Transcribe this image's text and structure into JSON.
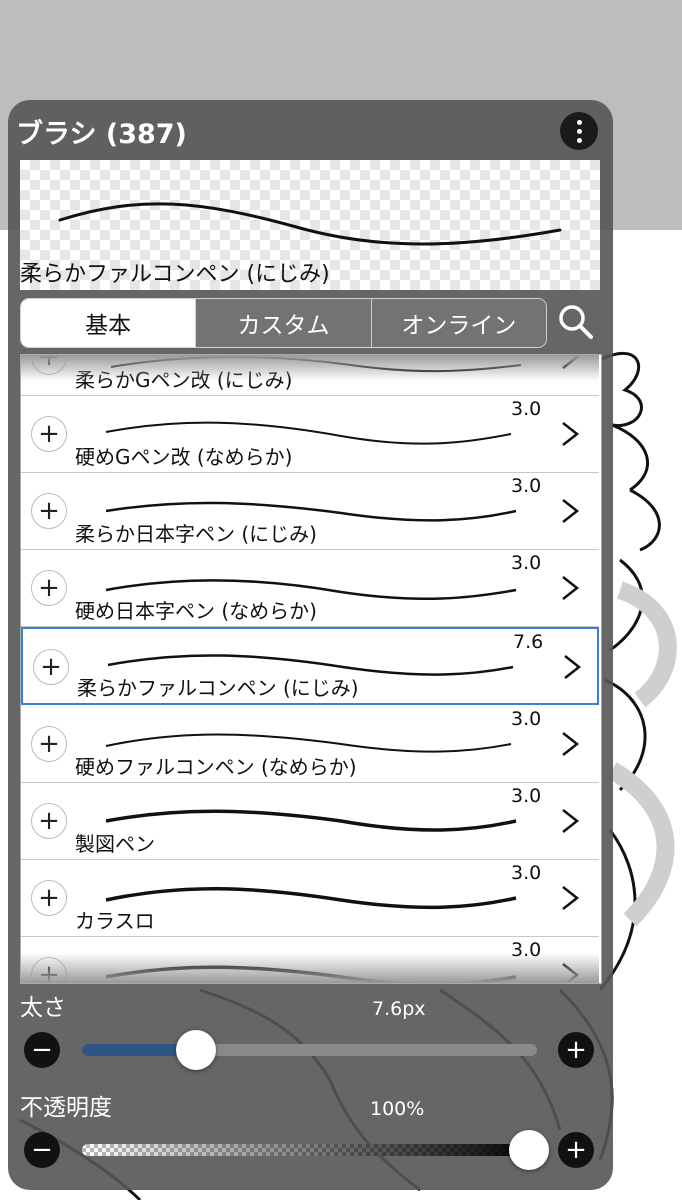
{
  "panel": {
    "title": "ブラシ (387)",
    "preview_name": "柔らかファルコンペン (にじみ)"
  },
  "tabs": [
    {
      "label": "基本",
      "active": true
    },
    {
      "label": "カスタム",
      "active": false
    },
    {
      "label": "オンライン",
      "active": false
    }
  ],
  "brushes": [
    {
      "name": "柔らかGペン改 (にじみ)",
      "size": ""
    },
    {
      "name": "硬めGペン改 (なめらか)",
      "size": "3.0"
    },
    {
      "name": "柔らか日本字ペン (にじみ)",
      "size": "3.0"
    },
    {
      "name": "硬め日本字ペン (なめらか)",
      "size": "3.0"
    },
    {
      "name": "柔らかファルコンペン (にじみ)",
      "size": "7.6",
      "selected": true
    },
    {
      "name": "硬めファルコンペン (なめらか)",
      "size": "3.0"
    },
    {
      "name": "製図ペン",
      "size": "3.0"
    },
    {
      "name": "カラスロ",
      "size": "3.0"
    },
    {
      "name": "",
      "size": "3.0"
    }
  ],
  "sliders": {
    "size": {
      "label": "太さ",
      "value_text": "7.6px",
      "fraction": 0.25
    },
    "opacity": {
      "label": "不透明度",
      "value_text": "100%",
      "fraction": 1.0
    }
  },
  "icons": {
    "menu": "more-vertical-icon",
    "search": "search-icon",
    "add": "plus-icon",
    "open": "chevron-right-icon",
    "minus": "minus-icon"
  },
  "colors": {
    "selection": "#3a7fd5",
    "slider_fill": "#2f5587"
  }
}
